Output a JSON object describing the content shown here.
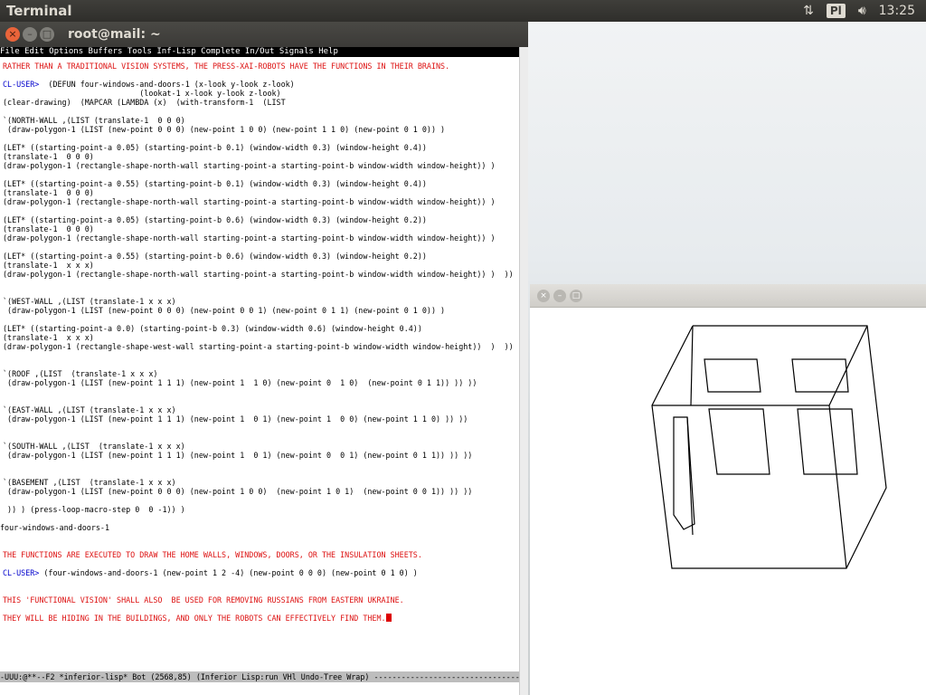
{
  "top_panel": {
    "app_name": "Terminal",
    "keyboard_layout": "Pl",
    "clock": "13:25",
    "network_icon": "transfer-arrows-icon",
    "volume_icon": "speaker-icon"
  },
  "terminal": {
    "title": "root@mail: ~",
    "menu": "File Edit Options Buffers Tools Inf-Lisp Complete In/Out Signals Help",
    "lines": [
      {
        "t": "RATHER THAN A TRADITIONAL VISION SYSTEMS, THE PRESS-XAI-ROBOTS HAVE THE FUNCTIONS IN THEIR BRAINS.",
        "c": "red"
      },
      {
        "t": "",
        "c": ""
      },
      {
        "t": "CL-USER>",
        "c": "blue",
        "rest": "  (DEFUN four-windows-and-doors-1 (x-look y-look z-look)"
      },
      {
        "t": "                              (lookat-1 x-look y-look z-look)",
        "c": ""
      },
      {
        "t": "(clear-drawing)  (MAPCAR (LAMBDA (x)  (with-transform-1  (LIST",
        "c": ""
      },
      {
        "t": "",
        "c": ""
      },
      {
        "t": "`(NORTH-WALL ,(LIST (translate-1  0 0 0)",
        "c": ""
      },
      {
        "t": " (draw-polygon-1 (LIST (new-point 0 0 0) (new-point 1 0 0) (new-point 1 1 0) (new-point 0 1 0)) )",
        "c": ""
      },
      {
        "t": "",
        "c": ""
      },
      {
        "t": "(LET* ((starting-point-a 0.05) (starting-point-b 0.1) (window-width 0.3) (window-height 0.4))",
        "c": ""
      },
      {
        "t": "(translate-1  0 0 0)",
        "c": ""
      },
      {
        "t": "(draw-polygon-1 (rectangle-shape-north-wall starting-point-a starting-point-b window-width window-height)) )",
        "c": ""
      },
      {
        "t": "",
        "c": ""
      },
      {
        "t": "(LET* ((starting-point-a 0.55) (starting-point-b 0.1) (window-width 0.3) (window-height 0.4))",
        "c": ""
      },
      {
        "t": "(translate-1  0 0 0)",
        "c": ""
      },
      {
        "t": "(draw-polygon-1 (rectangle-shape-north-wall starting-point-a starting-point-b window-width window-height)) )",
        "c": ""
      },
      {
        "t": "",
        "c": ""
      },
      {
        "t": "(LET* ((starting-point-a 0.05) (starting-point-b 0.6) (window-width 0.3) (window-height 0.2))",
        "c": ""
      },
      {
        "t": "(translate-1  0 0 0)",
        "c": ""
      },
      {
        "t": "(draw-polygon-1 (rectangle-shape-north-wall starting-point-a starting-point-b window-width window-height)) )",
        "c": ""
      },
      {
        "t": "",
        "c": ""
      },
      {
        "t": "(LET* ((starting-point-a 0.55) (starting-point-b 0.6) (window-width 0.3) (window-height 0.2))",
        "c": ""
      },
      {
        "t": "(translate-1  x x x)",
        "c": ""
      },
      {
        "t": "(draw-polygon-1 (rectangle-shape-north-wall starting-point-a starting-point-b window-width window-height)) )  ))",
        "c": ""
      },
      {
        "t": "",
        "c": ""
      },
      {
        "t": "",
        "c": ""
      },
      {
        "t": "`(WEST-WALL ,(LIST (translate-1 x x x)",
        "c": ""
      },
      {
        "t": " (draw-polygon-1 (LIST (new-point 0 0 0) (new-point 0 0 1) (new-point 0 1 1) (new-point 0 1 0)) )",
        "c": ""
      },
      {
        "t": "",
        "c": ""
      },
      {
        "t": "(LET* ((starting-point-a 0.0) (starting-point-b 0.3) (window-width 0.6) (window-height 0.4))",
        "c": ""
      },
      {
        "t": "(translate-1  x x x)",
        "c": ""
      },
      {
        "t": "(draw-polygon-1 (rectangle-shape-west-wall starting-point-a starting-point-b window-width window-height))  )  ))",
        "c": ""
      },
      {
        "t": "",
        "c": ""
      },
      {
        "t": "",
        "c": ""
      },
      {
        "t": "`(ROOF ,(LIST  (translate-1 x x x)",
        "c": ""
      },
      {
        "t": " (draw-polygon-1 (LIST (new-point 1 1 1) (new-point 1  1 0) (new-point 0  1 0)  (new-point 0 1 1)) )) ))",
        "c": ""
      },
      {
        "t": "",
        "c": ""
      },
      {
        "t": "",
        "c": ""
      },
      {
        "t": "`(EAST-WALL ,(LIST (translate-1 x x x)",
        "c": ""
      },
      {
        "t": " (draw-polygon-1 (LIST (new-point 1 1 1) (new-point 1  0 1) (new-point 1  0 0) (new-point 1 1 0) )) ))",
        "c": ""
      },
      {
        "t": "",
        "c": ""
      },
      {
        "t": "",
        "c": ""
      },
      {
        "t": "`(SOUTH-WALL ,(LIST  (translate-1 x x x)",
        "c": ""
      },
      {
        "t": " (draw-polygon-1 (LIST (new-point 1 1 1) (new-point 1  0 1) (new-point 0  0 1) (new-point 0 1 1)) )) ))",
        "c": ""
      },
      {
        "t": "",
        "c": ""
      },
      {
        "t": "",
        "c": ""
      },
      {
        "t": "`(BASEMENT ,(LIST  (translate-1 x x x)",
        "c": ""
      },
      {
        "t": " (draw-polygon-1 (LIST (new-point 0 0 0) (new-point 1 0 0)  (new-point 1 0 1)  (new-point 0 0 1)) )) ))",
        "c": ""
      },
      {
        "t": "",
        "c": ""
      },
      {
        "t": " )) ) (press-loop-macro-step 0  0 -1)) )",
        "c": ""
      },
      {
        "t": "",
        "c": ""
      },
      {
        "t": "four-windows-and-doors-1",
        "c": "",
        "noindent": true
      },
      {
        "t": "",
        "c": ""
      },
      {
        "t": "",
        "c": ""
      },
      {
        "t": "THE FUNCTIONS ARE EXECUTED TO DRAW THE HOME WALLS, WINDOWS, DOORS, OR THE INSULATION SHEETS.",
        "c": "red"
      },
      {
        "t": "",
        "c": ""
      },
      {
        "t": "CL-USER>",
        "c": "blue",
        "rest": " (four-windows-and-doors-1 (new-point 1 2 -4) (new-point 0 0 0) (new-point 0 1 0) )"
      },
      {
        "t": "",
        "c": ""
      },
      {
        "t": "",
        "c": ""
      },
      {
        "t": "THIS 'FUNCTIONAL VISION' SHALL ALSO  BE USED FOR REMOVING RUSSIANS FROM EASTERN UKRAINE.",
        "c": "red"
      },
      {
        "t": "",
        "c": ""
      },
      {
        "t": "THEY WILL BE HIDING IN THE BUILDINGS, AND ONLY THE ROBOTS CAN EFFECTIVELY FIND THEM.",
        "c": "red",
        "cursor": true
      }
    ],
    "modeline": "-UUU:@**--F2  *inferior-lisp*   Bot (2568,85)  (Inferior Lisp:run VHl Undo-Tree Wrap) -----------------------------------------"
  },
  "viewer": {
    "title": ""
  }
}
